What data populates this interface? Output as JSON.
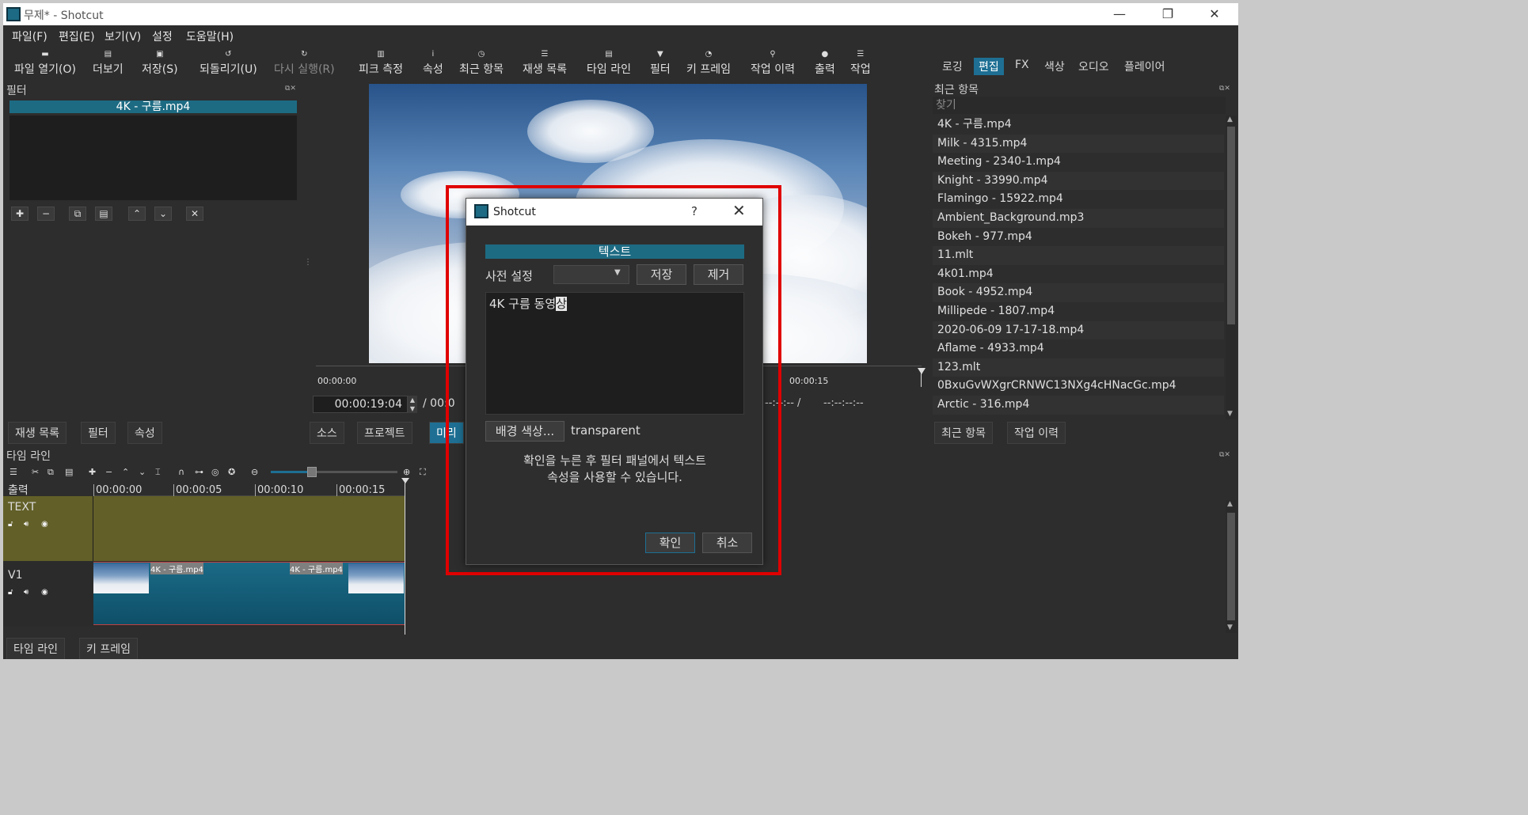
{
  "window": {
    "title": "무제* - Shotcut",
    "controls": {
      "minimize": "—",
      "restore": "❐",
      "close": "✕"
    }
  },
  "menu": [
    "파일(F)",
    "편집(E)",
    "보기(V)",
    "설정",
    "도움말(H)"
  ],
  "toolbar": {
    "open": "파일 열기(O)",
    "more": "더보기",
    "save": "저장(S)",
    "undo": "되돌리기(U)",
    "redo": "다시 실행(R)",
    "peak": "피크 측정",
    "properties": "속성",
    "recent": "최근 항목",
    "playlist": "재생 목록",
    "timeline": "타임 라인",
    "filter": "필터",
    "keyframes": "키 프레임",
    "jobs": "작업 이력",
    "export": "출력",
    "work": "작업"
  },
  "workspaces": [
    "로깅",
    "편집",
    "FX",
    "색상",
    "오디오",
    "플레이어"
  ],
  "filters_panel": {
    "title": "필터",
    "selected_clip": "4K - 구름.mp4"
  },
  "player": {
    "ruler_labels": [
      "00:00:00",
      "00:00:15"
    ],
    "timecode": "00:00:19:04",
    "timecode_sep": "/ 00:0",
    "right_tc": "--:--:-- /",
    "right_tc2": "--:--:--:--"
  },
  "left_tabs": [
    "재생 목록",
    "필터",
    "속성"
  ],
  "player_tabs": [
    "소스",
    "프로젝트",
    "미리"
  ],
  "recent_panel": {
    "title": "최근 항목",
    "search_placeholder": "찾기",
    "items": [
      "4K - 구름.mp4",
      "Milk - 4315.mp4",
      "Meeting - 2340-1.mp4",
      "Knight - 33990.mp4",
      "Flamingo - 15922.mp4",
      "Ambient_Background.mp3",
      "Bokeh - 977.mp4",
      "11.mlt",
      "4k01.mp4",
      "Book - 4952.mp4",
      "Millipede - 1807.mp4",
      "2020-06-09 17-17-18.mp4",
      "Aflame - 4933.mp4",
      "123.mlt",
      "0BxuGvWXgrCRNWC13NXg4cHNacGc.mp4",
      "Arctic - 316.mp4"
    ],
    "tabs": [
      "최근 항목",
      "작업 이력"
    ]
  },
  "timeline": {
    "title": "타임 라인",
    "output_label": "출력",
    "ruler": [
      "00:00:00",
      "00:00:05",
      "00:00:10",
      "00:00:15"
    ],
    "tracks": [
      {
        "name": "TEXT"
      },
      {
        "name": "V1"
      }
    ],
    "clip_labels": [
      "4K - 구름.mp4",
      "4K - 구름.mp4"
    ]
  },
  "bottom_tabs": [
    "타임 라인",
    "키 프레임"
  ],
  "dialog": {
    "title": "Shotcut",
    "help": "?",
    "close": "✕",
    "header": "텍스트",
    "preset_label": "사전 설정",
    "save": "저장",
    "remove": "제거",
    "text_value": "4K 구름 동영",
    "text_cursor_char": "상",
    "bgcolor_button": "배경 색상...",
    "bgcolor_value": "transparent",
    "info_line1": "확인을 누른 후 필터 패널에서 텍스트",
    "info_line2": "속성을 사용할 수 있습니다.",
    "ok": "확인",
    "cancel": "취소"
  },
  "colors": {
    "accent": "#1e6f93",
    "highlight": "#e00000",
    "text_track": "#625f28"
  }
}
